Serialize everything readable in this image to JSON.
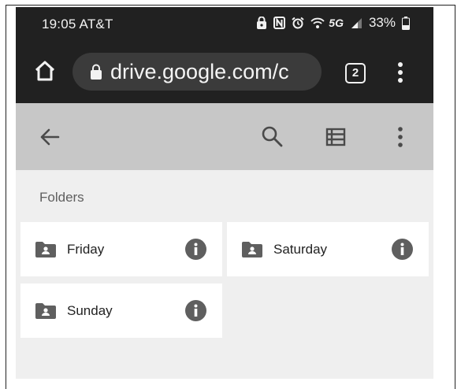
{
  "status_bar": {
    "time": "19:05",
    "carrier": "AT&T",
    "network": "5G",
    "battery": "33%"
  },
  "browser": {
    "url": "drive.google.com/c",
    "tab_count": "2"
  },
  "section": {
    "label": "Folders"
  },
  "folders": [
    {
      "name": "Friday"
    },
    {
      "name": "Saturday"
    },
    {
      "name": "Sunday"
    }
  ],
  "colors": {
    "status_bar_bg": "#212121",
    "toolbar_bg": "#c7c7c7",
    "content_bg": "#efefef",
    "card_bg": "#ffffff",
    "icon_gray": "#5f5f5f"
  }
}
